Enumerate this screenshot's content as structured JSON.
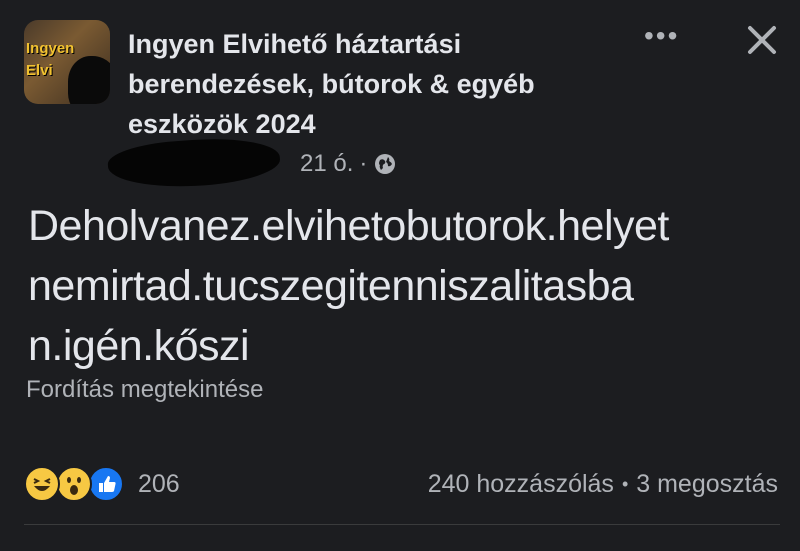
{
  "post": {
    "group_name": "Ingyen Elvihető háztartási berendezések, bútorok & egyéb eszközök 2024",
    "avatar_text_1": "Ingyen",
    "avatar_text_2": "Elvi",
    "time": "21 ó.",
    "separator": "·",
    "privacy_icon": "globe-icon",
    "body_lines": [
      "Deholvanez.elvihetobutorok.helyet",
      "nemirtad.tucszegitenniszalitasba",
      "n.igén.kőszi"
    ],
    "translate_label": "Fordítás megtekintése"
  },
  "footer": {
    "reactions": [
      "haha-icon",
      "wow-icon",
      "like-icon"
    ],
    "reaction_count": "206",
    "comments": "240 hozzászólás",
    "dot": "•",
    "shares": "3 megosztás"
  },
  "colors": {
    "background": "#1c1d20",
    "text_primary": "#e4e6eb",
    "text_secondary": "#b0b3b8",
    "like_blue": "#1877f2",
    "reaction_yellow": "#f7c843"
  }
}
